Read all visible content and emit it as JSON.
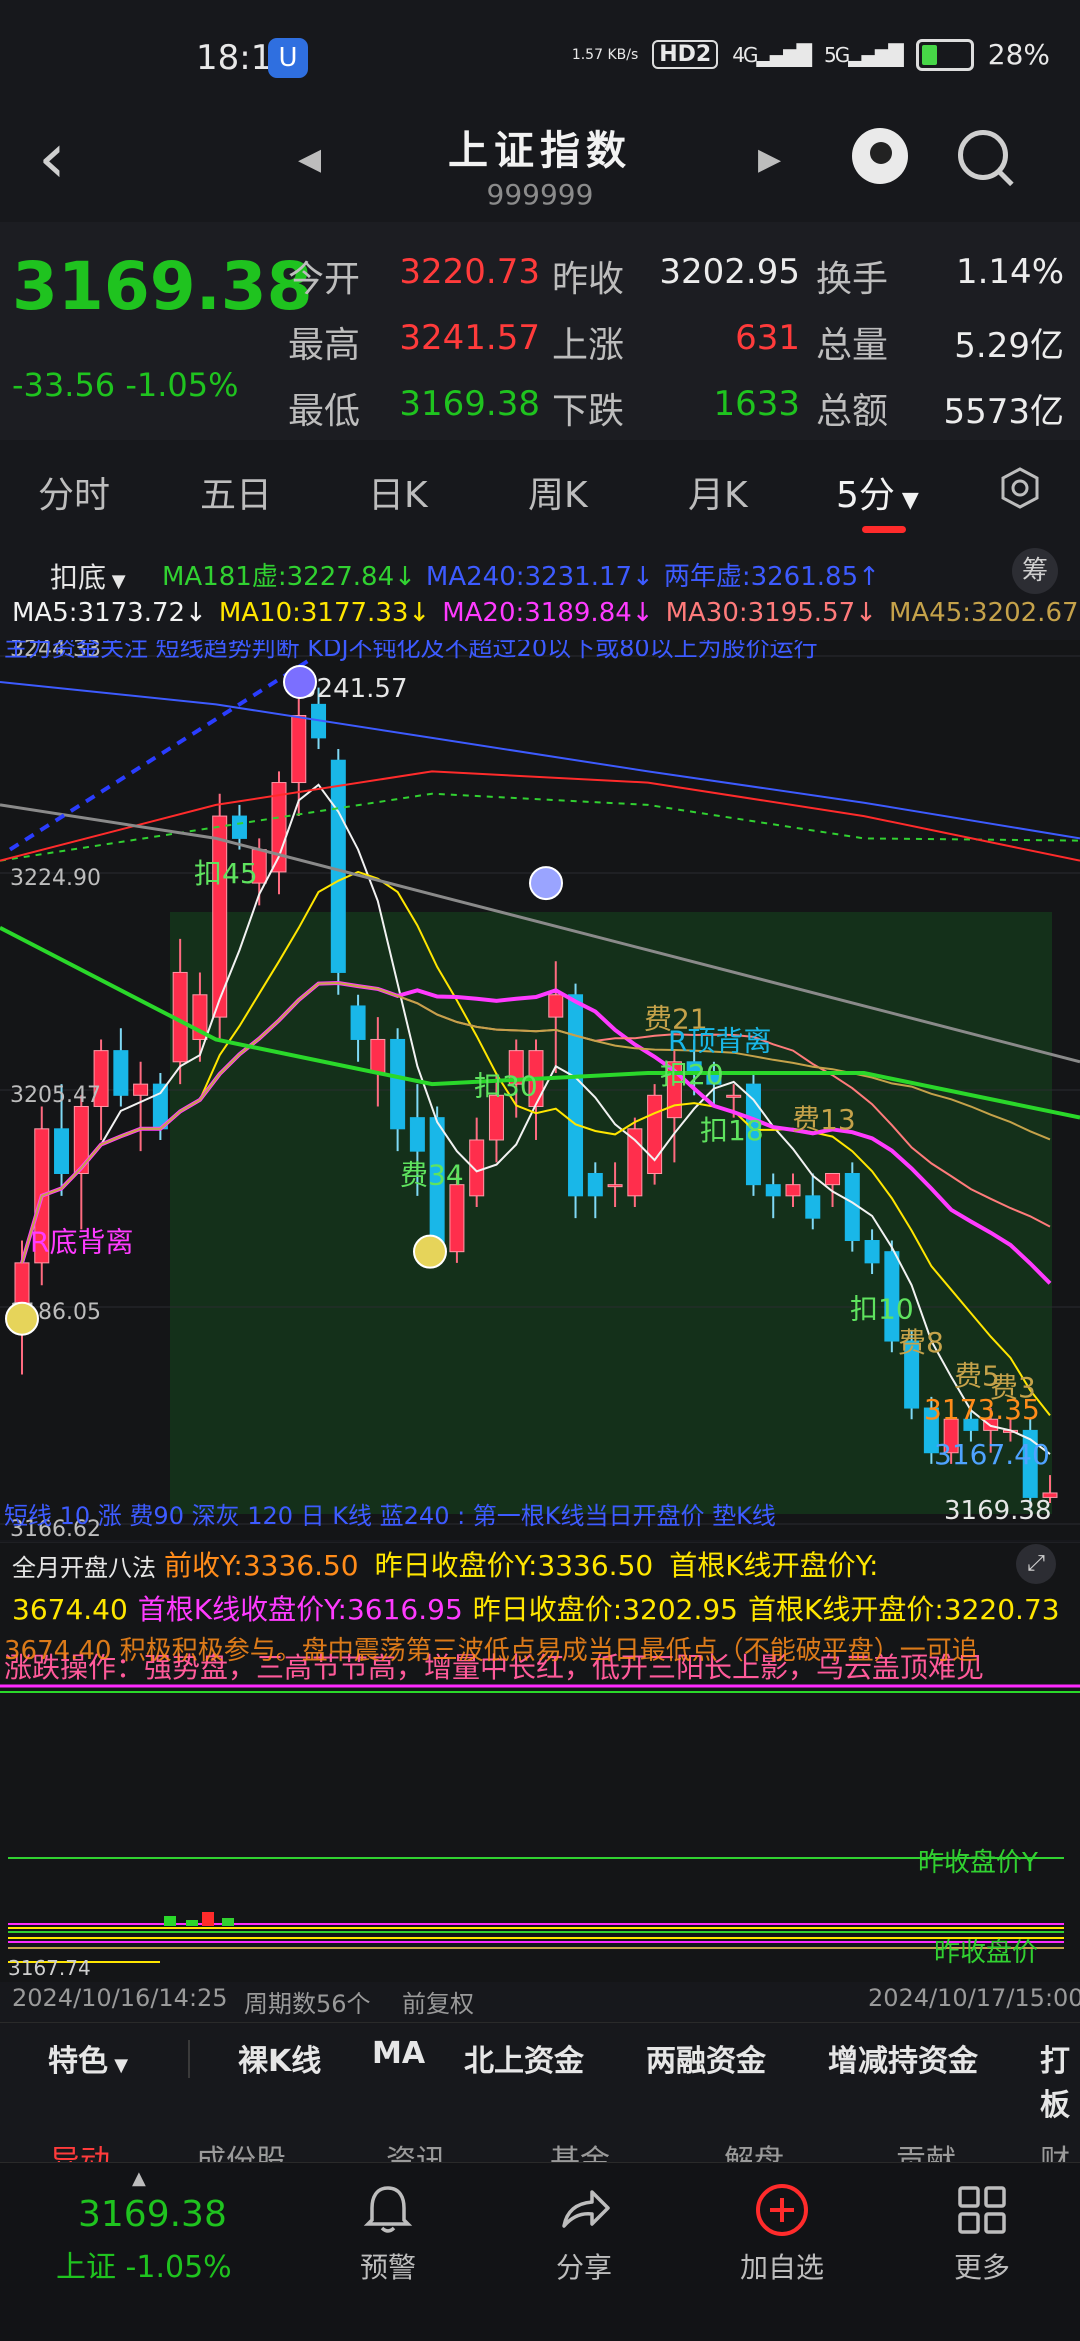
{
  "status": {
    "time": "18:15",
    "app_badge": "U",
    "net_speed": "1.57\nKB/s",
    "hd": "HD2",
    "sig1": "4G",
    "sig2": "5G",
    "battery": "28%"
  },
  "nav": {
    "title": "上证指数",
    "code": "999999"
  },
  "quote": {
    "price": "3169.38",
    "change": "-33.56 -1.05%",
    "fields": [
      {
        "label": "今开",
        "value": "3220.73",
        "color": "red"
      },
      {
        "label": "昨收",
        "value": "3202.95",
        "color": "white"
      },
      {
        "label": "换手",
        "value": "1.14%",
        "color": "white"
      },
      {
        "label": "最高",
        "value": "3241.57",
        "color": "red"
      },
      {
        "label": "上涨",
        "value": "631",
        "color": "red"
      },
      {
        "label": "总量",
        "value": "5.29亿",
        "color": "white"
      },
      {
        "label": "最低",
        "value": "3169.38",
        "color": "green"
      },
      {
        "label": "下跌",
        "value": "1633",
        "color": "green"
      },
      {
        "label": "总额",
        "value": "5573亿",
        "color": "white"
      }
    ]
  },
  "tabs": [
    "分时",
    "五日",
    "日K",
    "周K",
    "月K",
    "5分"
  ],
  "indicators": {
    "mode": "扣底",
    "row1": [
      {
        "text": "MA181虚:3227.84↓",
        "color": "#31d131"
      },
      {
        "text": "MA240:3231.17↓",
        "color": "#3d5bff"
      },
      {
        "text": "两年虚:3261.85↑",
        "color": "#3d5bff"
      }
    ],
    "chip_button": "筹",
    "row2": [
      {
        "text": "MA5:3173.72↓",
        "color": "#f2f2f2"
      },
      {
        "text": "MA10:3177.33↓",
        "color": "#ffe600"
      },
      {
        "text": "MA20:3189.84↓",
        "color": "#ff3bff"
      },
      {
        "text": "MA30:3195.57↓",
        "color": "#ff7b7b"
      },
      {
        "text": "MA45:3202.67",
        "color": "#c5a24a"
      }
    ]
  },
  "chart_data": {
    "type": "candlestick",
    "y_tick_labels": [
      "3244.33",
      "3224.90",
      "3205.47",
      "3186.05",
      "3166.62"
    ],
    "ylim": [
      3166.62,
      3244.33
    ],
    "high_label": "3241.57",
    "low_label": "3169.38",
    "annotations": [
      "扣45",
      "扣30",
      "费34",
      "费21",
      "R底背离",
      "扣20",
      "扣18",
      "费13",
      "扣10",
      "费8",
      "费5",
      "费3",
      "3173.35",
      "3167.40",
      "R顶背离"
    ],
    "candles": [
      {
        "o": 3184,
        "h": 3192,
        "l": 3180,
        "c": 3190
      },
      {
        "o": 3190,
        "h": 3204,
        "l": 3188,
        "c": 3202
      },
      {
        "o": 3202,
        "h": 3206,
        "l": 3196,
        "c": 3198
      },
      {
        "o": 3198,
        "h": 3205,
        "l": 3193,
        "c": 3204
      },
      {
        "o": 3204,
        "h": 3210,
        "l": 3201,
        "c": 3209
      },
      {
        "o": 3209,
        "h": 3211,
        "l": 3204,
        "c": 3205
      },
      {
        "o": 3205,
        "h": 3208,
        "l": 3200,
        "c": 3206
      },
      {
        "o": 3206,
        "h": 3207,
        "l": 3201,
        "c": 3202
      },
      {
        "o": 3208,
        "h": 3219,
        "l": 3206,
        "c": 3216
      },
      {
        "o": 3210,
        "h": 3216,
        "l": 3208,
        "c": 3214
      },
      {
        "o": 3212,
        "h": 3232,
        "l": 3210,
        "c": 3230
      },
      {
        "o": 3230,
        "h": 3231,
        "l": 3227,
        "c": 3228
      },
      {
        "o": 3224,
        "h": 3228,
        "l": 3222,
        "c": 3227
      },
      {
        "o": 3225,
        "h": 3234,
        "l": 3223,
        "c": 3233
      },
      {
        "o": 3233,
        "h": 3241,
        "l": 3230,
        "c": 3239
      },
      {
        "o": 3240,
        "h": 3241.5,
        "l": 3236,
        "c": 3237
      },
      {
        "o": 3235,
        "h": 3236,
        "l": 3214,
        "c": 3216
      },
      {
        "o": 3213,
        "h": 3214,
        "l": 3208,
        "c": 3210
      },
      {
        "o": 3207,
        "h": 3212,
        "l": 3204,
        "c": 3210
      },
      {
        "o": 3210,
        "h": 3211,
        "l": 3200,
        "c": 3202
      },
      {
        "o": 3203,
        "h": 3206,
        "l": 3196,
        "c": 3200
      },
      {
        "o": 3203,
        "h": 3204,
        "l": 3190,
        "c": 3191
      },
      {
        "o": 3191,
        "h": 3198,
        "l": 3190,
        "c": 3197
      },
      {
        "o": 3196,
        "h": 3203,
        "l": 3195,
        "c": 3201
      },
      {
        "o": 3201,
        "h": 3207,
        "l": 3199,
        "c": 3205
      },
      {
        "o": 3206,
        "h": 3210,
        "l": 3203,
        "c": 3209
      },
      {
        "o": 3204,
        "h": 3210,
        "l": 3201,
        "c": 3209
      },
      {
        "o": 3212,
        "h": 3217,
        "l": 3207,
        "c": 3214
      },
      {
        "o": 3214,
        "h": 3215,
        "l": 3194,
        "c": 3196
      },
      {
        "o": 3198,
        "h": 3199,
        "l": 3194,
        "c": 3196
      },
      {
        "o": 3197,
        "h": 3199,
        "l": 3195,
        "c": 3197
      },
      {
        "o": 3196,
        "h": 3203,
        "l": 3195,
        "c": 3202
      },
      {
        "o": 3198,
        "h": 3206,
        "l": 3197,
        "c": 3205
      },
      {
        "o": 3203,
        "h": 3209,
        "l": 3199,
        "c": 3208
      },
      {
        "o": 3208,
        "h": 3210,
        "l": 3205,
        "c": 3207
      },
      {
        "o": 3207,
        "h": 3208,
        "l": 3204,
        "c": 3206
      },
      {
        "o": 3205,
        "h": 3206,
        "l": 3203,
        "c": 3205
      },
      {
        "o": 3206,
        "h": 3207,
        "l": 3196,
        "c": 3197
      },
      {
        "o": 3197,
        "h": 3198,
        "l": 3194,
        "c": 3196
      },
      {
        "o": 3196,
        "h": 3198,
        "l": 3195,
        "c": 3197
      },
      {
        "o": 3196,
        "h": 3198,
        "l": 3193,
        "c": 3194
      },
      {
        "o": 3197,
        "h": 3198,
        "l": 3195,
        "c": 3198
      },
      {
        "o": 3198,
        "h": 3199,
        "l": 3191,
        "c": 3192
      },
      {
        "o": 3192,
        "h": 3193,
        "l": 3189,
        "c": 3190
      },
      {
        "o": 3191,
        "h": 3192,
        "l": 3182,
        "c": 3183
      },
      {
        "o": 3183,
        "h": 3184,
        "l": 3176,
        "c": 3177
      },
      {
        "o": 3177,
        "h": 3178,
        "l": 3172,
        "c": 3173
      },
      {
        "o": 3173,
        "h": 3177,
        "l": 3172,
        "c": 3176
      },
      {
        "o": 3176,
        "h": 3177,
        "l": 3174,
        "c": 3175
      },
      {
        "o": 3175,
        "h": 3177,
        "l": 3173,
        "c": 3176
      },
      {
        "o": 3175,
        "h": 3176,
        "l": 3174,
        "c": 3175
      },
      {
        "o": 3175,
        "h": 3176,
        "l": 3168,
        "c": 3169
      },
      {
        "o": 3169,
        "h": 3171,
        "l": 3168.5,
        "c": 3169.4
      }
    ]
  },
  "chart_overlay": {
    "top_ticker": "主力资金关注 短线趋势判断 KDJ不钝化及不超过20以下或80以上为股价运行",
    "bottom_ticker": "短线 10 涨 费90 深灰 120 日 K线 蓝240 : 第一根K线当日开盘价 垫K线"
  },
  "subpanel": {
    "title": "全月开盘八法",
    "line1": [
      {
        "text": "前收Y:3336.50",
        "color": "#ff8c1a"
      },
      {
        "text": "昨日收盘价Y:3336.50",
        "color": "#ffe600"
      },
      {
        "text": "首根K线开盘价Y:",
        "color": "#ffe600"
      }
    ],
    "line2": [
      {
        "text": "3674.40",
        "color": "#ffe600"
      },
      {
        "text": "首根K线收盘价Y:3616.95",
        "color": "#ff3bff"
      },
      {
        "text": "昨日收盘价:3202.95",
        "color": "#ffe600"
      },
      {
        "text": "首根K线开盘价:3220.73",
        "color": "#ffe600"
      }
    ],
    "line3": "涨跌操作：强势盘，三高节节高，增量中长红，低开三阳长上影，乌云盖顶难见",
    "line4": "3674.40 积极积极参与。盘中震荡第三波低点易成当日最低点（不能破平盘）一可追",
    "right_label1": "昨收盘价Y",
    "right_label2": "昨收盘价",
    "low_label": "3167.74",
    "footer_left": "2024/10/16/14:25",
    "footer_mid1": "周期数56个",
    "footer_mid2": "前复权",
    "footer_right": "2024/10/17/15:00"
  },
  "features": [
    "特色",
    "裸K线",
    "MA",
    "北上资金",
    "两融资金",
    "增减持资金",
    "打板"
  ],
  "subtabs": [
    "异动",
    "成份股",
    "资讯",
    "基金",
    "解盘",
    "贡献",
    "财"
  ],
  "bottom": {
    "price": "3169.38",
    "name_change": "上证 -1.05%",
    "items": [
      "预警",
      "分享",
      "加自选",
      "更多"
    ]
  }
}
